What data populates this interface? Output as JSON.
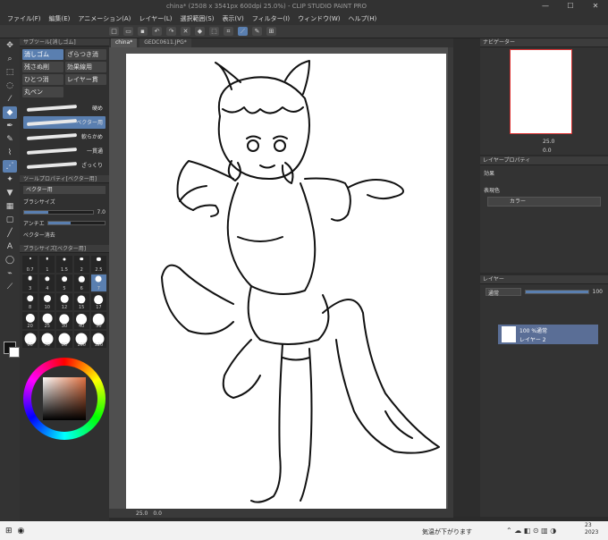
{
  "window": {
    "title": "china* (2508 x 3541px 600dpi 25.0%)  - CLIP STUDIO PAINT PRO",
    "minimize": "—",
    "maximize": "☐",
    "close": "✕"
  },
  "menu": [
    "ファイル(F)",
    "編集(E)",
    "アニメーション(A)",
    "レイヤー(L)",
    "選択範囲(S)",
    "表示(V)",
    "フィルター(I)",
    "ウィンドウ(W)",
    "ヘルプ(H)"
  ],
  "toolbar_icons": [
    "new-icon",
    "open-icon",
    "save-icon",
    "undo-icon",
    "redo-icon",
    "clear-icon",
    "fill-icon",
    "transform-icon",
    "snap-icon",
    "ruler-icon",
    "pen-icon",
    "guide-icon"
  ],
  "tools": [
    "move",
    "zoom",
    "select",
    "lasso",
    "eyedropper",
    "pen",
    "pencil",
    "brush",
    "airbrush",
    "decoration",
    "eraser",
    "fill",
    "gradient",
    "figure",
    "text",
    "balloon",
    "line",
    "correct"
  ],
  "subtool": {
    "header": "サブツール[消しゴム]",
    "items": [
      {
        "label": "消しゴム",
        "active": true
      },
      {
        "label": "ざらつき消",
        "active": false
      },
      {
        "label": "残さぬ削",
        "active": false
      },
      {
        "label": "効果線用",
        "active": false
      },
      {
        "label": "ひとつ消",
        "active": false
      },
      {
        "label": "レイヤー貫",
        "active": false
      },
      {
        "label": "丸ペン",
        "active": false
      }
    ],
    "brushes": [
      {
        "label": "硬め",
        "active": false
      },
      {
        "label": "ベクター用",
        "active": true
      },
      {
        "label": "軟らかめ",
        "active": false
      },
      {
        "label": "一貫通",
        "active": false
      },
      {
        "label": "ざっくり",
        "active": false
      }
    ]
  },
  "toolprop": {
    "header": "ツールプロパティ[ベクター用]",
    "name": "ベクター用",
    "size_label": "ブラシサイズ",
    "size_value": "7.0",
    "antialias_label": "アンチエ",
    "vector_erase_label": "ベクター消去"
  },
  "brushsize": {
    "header": "ブラシサイズ[ベクター用]",
    "sizes": [
      "0.7",
      "1",
      "1.5",
      "2",
      "2.5",
      "3",
      "4",
      "5",
      "6",
      "7",
      "8",
      "10",
      "12",
      "15",
      "17",
      "20",
      "25",
      "30",
      "40",
      "50",
      "60",
      "70",
      "80",
      "100",
      "120"
    ],
    "selected": "7"
  },
  "canvas": {
    "tabs": [
      {
        "label": "china*",
        "active": true
      },
      {
        "label": "GEDC0611.JPG*",
        "active": false
      }
    ],
    "status_zoom": "25.0",
    "status_angle": "0.0"
  },
  "navigator": {
    "header": "ナビゲーター",
    "zoom": "25.0",
    "angle": "0.0"
  },
  "layerprop": {
    "header": "レイヤープロパティ",
    "effect_label": "効果",
    "color_label": "表現色",
    "color_value": "カラー"
  },
  "layers": {
    "header": "レイヤー",
    "blend_mode": "通常",
    "opacity": "100",
    "rows": [
      {
        "opacity_mode": "100 %通常",
        "name": "レイヤー 2"
      }
    ]
  },
  "taskbar": {
    "weather": "気温が下がります",
    "clock_line1": "23",
    "clock_line2": "2023"
  },
  "colors": {
    "accent": "#5a7fb0",
    "panel": "#303030",
    "canvas_bg": "#4f4f4f",
    "layer_selected": "#5a6e96"
  }
}
